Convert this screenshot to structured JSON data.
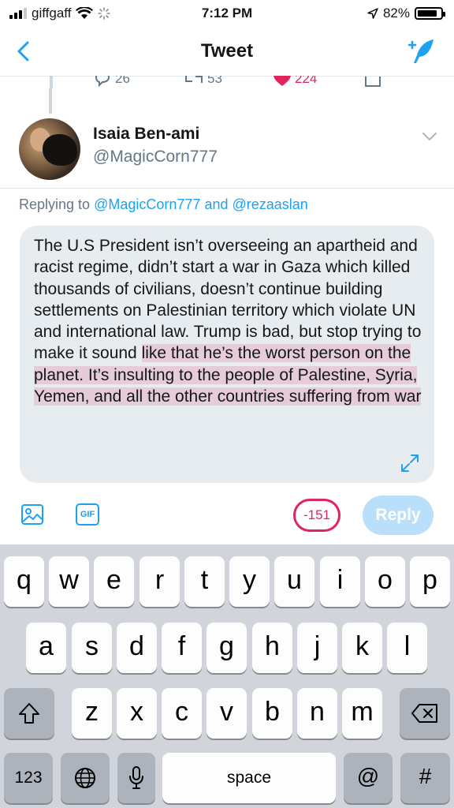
{
  "status_bar": {
    "carrier": "giffgaff",
    "time": "7:12 PM",
    "battery": "82%"
  },
  "nav": {
    "title": "Tweet"
  },
  "previous_tweet": {
    "replies": "26",
    "retweets": "53",
    "likes": "224"
  },
  "author": {
    "name": "Isaia Ben-ami",
    "handle": "@MagicCorn777"
  },
  "replying": {
    "prefix": "Replying to",
    "mention1": "@MagicCorn777",
    "joiner": "and",
    "mention2": "@rezaaslan"
  },
  "composer": {
    "text_within_limit": "The U.S President isn’t overseeing an apartheid and racist regime, didn’t start a war in Gaza which killed thousands of civilians, doesn’t continue building settlements on Palestinian territory which violate UN and international law. Trump is bad, but stop trying to make it sound ",
    "text_over_limit": "like that he’s the worst person on the planet. It’s insulting to the people of Palestine, Syria, Yemen, and all the other countries suffering from war"
  },
  "toolbar": {
    "gif_label": "GIF",
    "char_count": "-151",
    "reply_label": "Reply"
  },
  "keyboard": {
    "row1": [
      "q",
      "w",
      "e",
      "r",
      "t",
      "y",
      "u",
      "i",
      "o",
      "p"
    ],
    "row2": [
      "a",
      "s",
      "d",
      "f",
      "g",
      "h",
      "j",
      "k",
      "l"
    ],
    "row3": [
      "z",
      "x",
      "c",
      "v",
      "b",
      "n",
      "m"
    ],
    "numbers_label": "123",
    "space_label": "space",
    "at_label": "@",
    "hash_label": "#"
  },
  "colors": {
    "accent": "#1da1f2",
    "danger": "#e0245e",
    "muted": "#657786"
  }
}
